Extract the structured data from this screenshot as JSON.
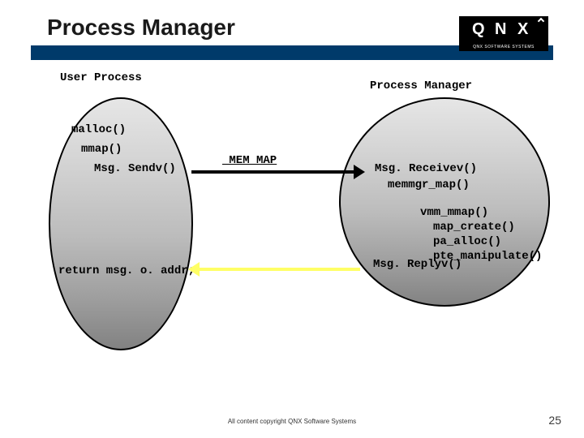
{
  "title": "Process Manager",
  "logo": {
    "q": "Q",
    "n": "N",
    "x": "X",
    "tag": "QNX SOFTWARE SYSTEMS"
  },
  "userProcess": {
    "heading": "User Process",
    "malloc": "malloc()",
    "mmap": "mmap()",
    "msgSendv": "Msg. Sendv()",
    "returnMsg": "return msg. o. addr;"
  },
  "arrowLabel": "_MEM_MAP",
  "procManager": {
    "heading": "Process Manager",
    "msgReceivev": "Msg. Receivev()",
    "memmgrMap": "memmgr_map()",
    "vmmMmap": "vmm_mmap()",
    "mapCreate": "map_create()",
    "paAlloc": "pa_alloc()",
    "pteManipulate": "pte_manipulate()",
    "msgReplyv": "Msg. Replyv()"
  },
  "footer": "All content copyright QNX Software Systems",
  "pageNumber": "25"
}
